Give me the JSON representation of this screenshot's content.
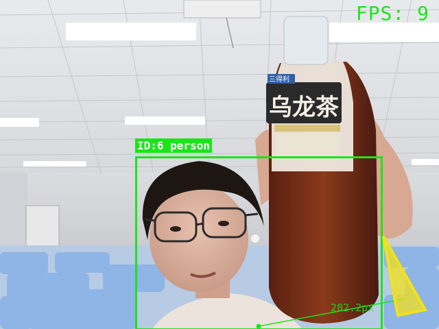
{
  "overlay": {
    "fps_text": "FPS: 9",
    "detection": {
      "label": "ID:6 person",
      "color": "#19e619"
    },
    "distance_text": "202.2px",
    "pointer_color": "#f2e21a"
  },
  "scene": {
    "bottle_label_text": "乌龙茶",
    "bottle_brand_text": "三得利"
  }
}
